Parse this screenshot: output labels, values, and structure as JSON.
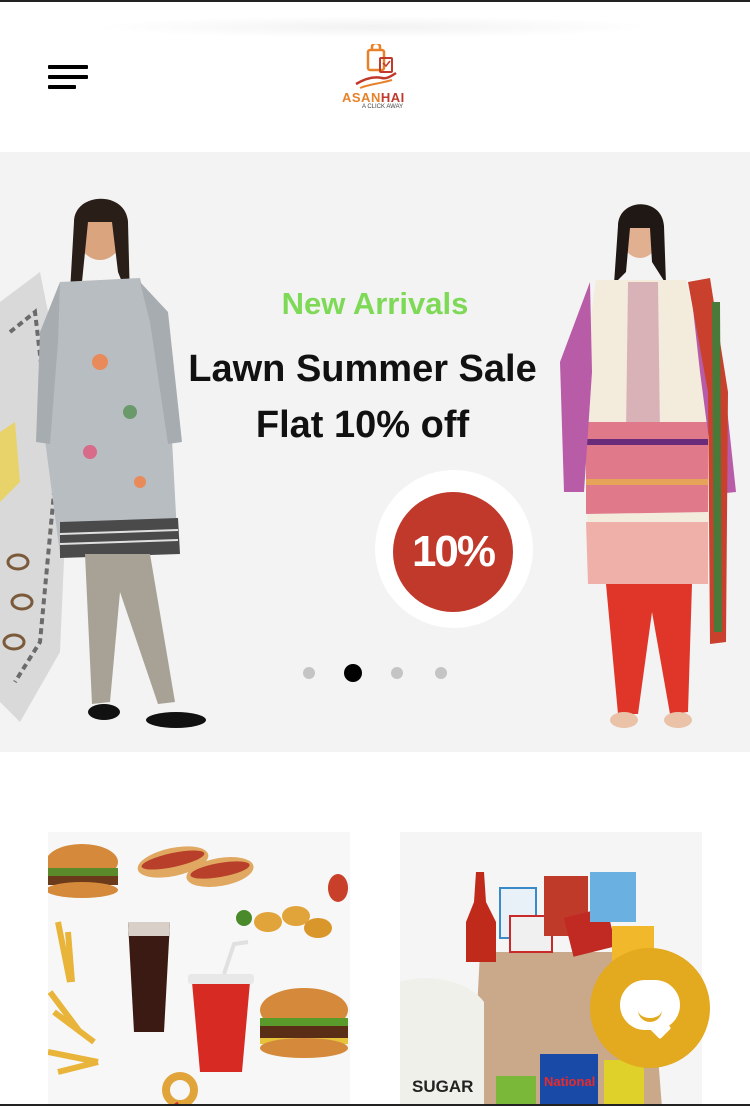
{
  "header": {
    "logo_name": "ASAN",
    "logo_name_accent": "HAI",
    "logo_tagline": "A CLICK AWAY"
  },
  "banner": {
    "kicker": "New Arrivals",
    "title": "Lawn Summer Sale",
    "subtitle": "Flat 10% off",
    "badge": "10%",
    "slide_count": 4,
    "active_slide": 2
  },
  "categories": [
    {
      "id": "food",
      "name": "food-category"
    },
    {
      "id": "grocery",
      "name": "grocery-category",
      "bag_label": "SUGAR",
      "packet_label": "National"
    }
  ],
  "colors": {
    "brand_orange": "#e8822a",
    "brand_red": "#c0392b",
    "kicker_green": "#7ed957",
    "chat": "#e3a91f"
  },
  "icons": {
    "menu": "hamburger-menu-icon",
    "chat": "chat-bubble-icon"
  }
}
